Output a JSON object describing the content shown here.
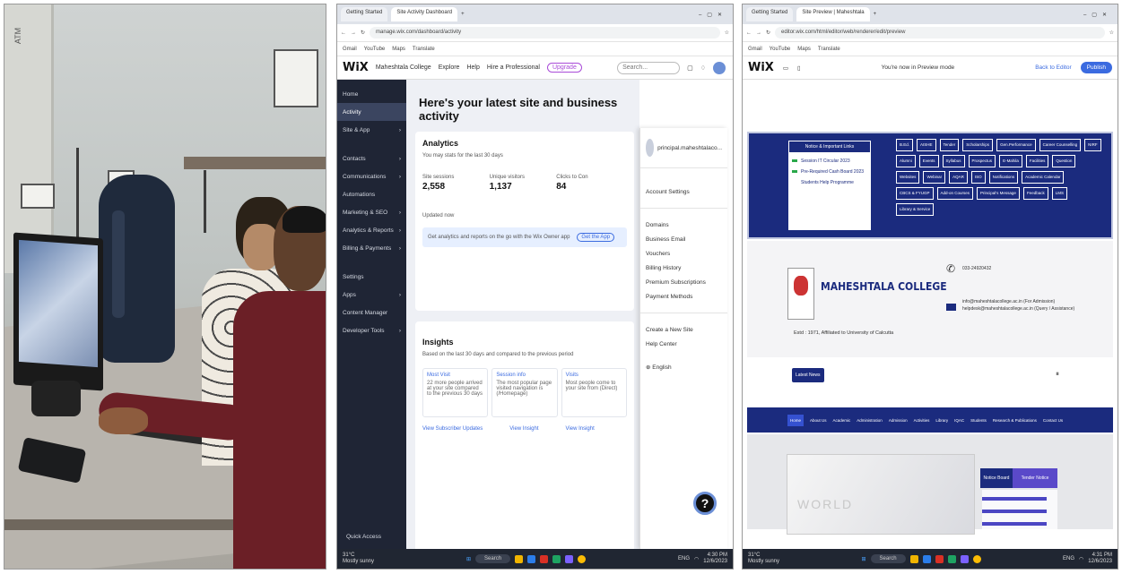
{
  "panel1": {
    "sign": "ATM"
  },
  "browser1": {
    "tabs": [
      "Getting Started",
      "Site Activity Dashboard"
    ],
    "url": "manage.wix.com/dashboard/activity",
    "bookmarks": [
      "Gmail",
      "YouTube",
      "Maps",
      "Translate"
    ],
    "wix": {
      "logo": "WiX",
      "site": "Maheshtala College",
      "explore": "Explore",
      "help": "Help",
      "hire": "Hire a Professional",
      "upgrade": "Upgrade",
      "search": "Search..."
    },
    "sidebar": [
      "Home",
      "Activity",
      "Site & App",
      "Contacts",
      "Communications",
      "Automations",
      "Marketing & SEO",
      "Analytics & Reports",
      "Billing & Payments",
      "Settings",
      "Apps",
      "Content Manager",
      "Developer Tools"
    ],
    "quick_access": "Quick Access",
    "headline": "Here's your latest site and business activity",
    "analytics": {
      "title": "Analytics",
      "sub": "You may stats for the last 30 days",
      "stats": [
        {
          "label": "Site sessions",
          "value": "2,558"
        },
        {
          "label": "Unique visitors",
          "value": "1,137"
        },
        {
          "label": "Clicks to Con",
          "value": "84"
        }
      ],
      "updated": "Updated now",
      "getapp": "Get analytics and reports on the go with the Wix Owner app",
      "getapp_btn": "Get the App"
    },
    "insights": {
      "title": "Insights",
      "sub": "Based on the last 30 days and compared to the previous period",
      "cells": [
        {
          "k": "Most Visit",
          "v": "22 more people arrived at your site compared to the previous 30 days"
        },
        {
          "k": "Session info",
          "v": "The most popular page visited navigation is (/Homepage)"
        },
        {
          "k": "Visits",
          "v": "Most people come to your site from (Direct)"
        }
      ],
      "links": [
        "View Subscriber Updates",
        "View Insight",
        "View Insight"
      ]
    },
    "dropdown": {
      "user": "principal.maheshtalaco...",
      "items1": [
        "Account Settings"
      ],
      "items2": [
        "Domains",
        "Business Email",
        "Vouchers",
        "Billing History",
        "Premium Subscriptions",
        "Payment Methods"
      ],
      "items3": [
        "Create a New Site",
        "Help Center"
      ],
      "lang": "English",
      "help": "?"
    },
    "taskbar": {
      "temp": "31°C",
      "weather": "Mostly sunny",
      "search": "Search",
      "lang": "ENG",
      "time": "4:30 PM",
      "date": "12/6/2023"
    }
  },
  "browser3": {
    "tabs": [
      "Getting Started",
      "Site Preview | Maheshtala"
    ],
    "url": "editor.wix.com/html/editor/web/renderer/edit/preview",
    "bookmarks": [
      "Gmail",
      "YouTube",
      "Maps",
      "Translate"
    ],
    "mode": "You're now in Preview mode",
    "back": "Back to Editor",
    "publish": "Publish",
    "notice_title": "Notice & Important Links",
    "notices": [
      "Session IT Circular 2023",
      "Pre-Required Cash Board 2023",
      "Students Help Programme"
    ],
    "links": [
      "B.Ed.",
      "AISHE",
      "Tender",
      "Scholarships",
      "Gen.Performance",
      "Career Counselling",
      "NIRF",
      "Alumni",
      "Events",
      "Syllabus",
      "Prospectus",
      "E-Mahila",
      "Facilities",
      "Question",
      "Websites",
      "Webinar",
      "AQAR",
      "ISO",
      "Notifications",
      "Academic Calendar",
      "CBCS & FYUGP",
      "Add-on Courses",
      "Principal's Message",
      "Feedback",
      "LMS",
      "Library & Service"
    ],
    "college": "MAHESHTALA COLLEGE",
    "estd": "Estd : 1971, Affiliated to University of Calcutta",
    "phone": "033-24920432",
    "email": "info@maheshtalacollege.ac.in (For Admission)\nhelpdesk@maheshtalacollege.ac.in (Query / Assistance)",
    "latest": "Latest News",
    "nav": [
      "Home",
      "About Us",
      "Academic",
      "Administration",
      "Admission",
      "Activities",
      "Library",
      "IQAC",
      "Students",
      "Research & Publications",
      "Contact Us"
    ],
    "hero_word": "WORLD",
    "notice_board": "Notice Board",
    "tender_notice": "Tender Notice",
    "taskbar": {
      "temp": "31°C",
      "weather": "Mostly sunny",
      "search": "Search",
      "lang": "ENG",
      "time": "4:31 PM",
      "date": "12/6/2023"
    }
  }
}
